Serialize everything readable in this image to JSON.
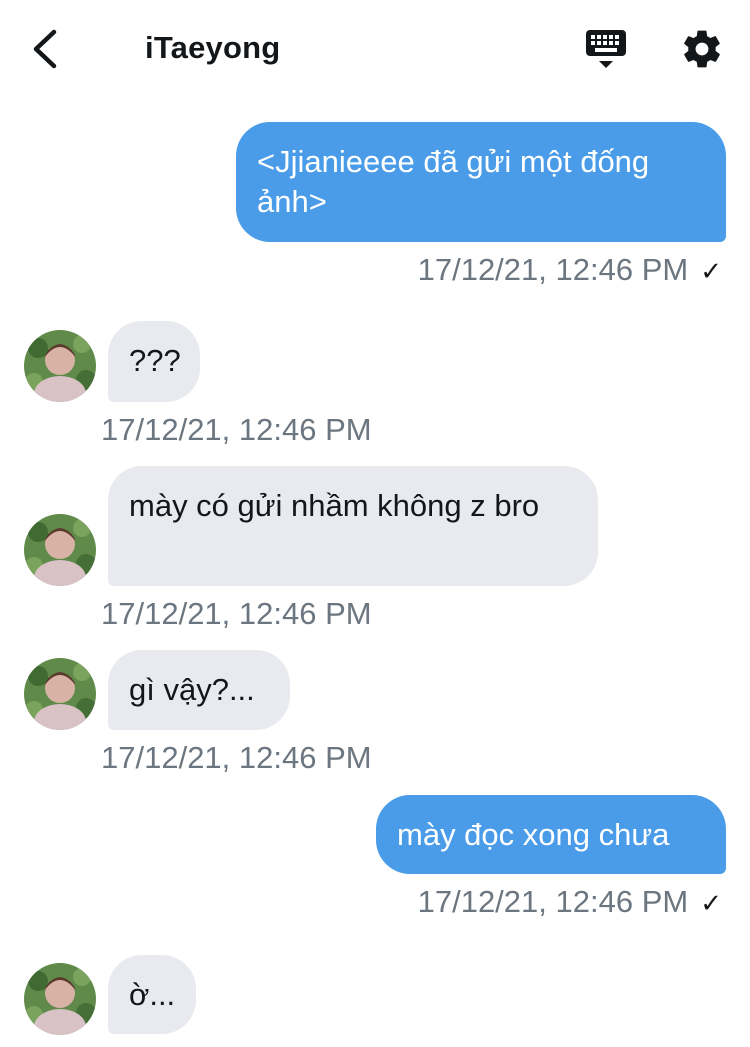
{
  "header": {
    "title": "iTaeyong",
    "icons": {
      "back": "chevron-left-icon",
      "keyboard": "keyboard-icon",
      "settings": "gear-icon"
    }
  },
  "colors": {
    "outgoing": "#4a9ce8",
    "incoming": "#e8eaef",
    "timestamp": "#6b7680"
  },
  "messages": [
    {
      "direction": "outgoing",
      "text": "<Jjianieeee đã gửi một đống ảnh>",
      "timestamp": "17/12/21, 12:46 PM",
      "status_icon": "check-icon"
    },
    {
      "direction": "incoming",
      "text": "???",
      "timestamp": "17/12/21, 12:46 PM"
    },
    {
      "direction": "incoming",
      "text": "mày có gửi nhầm không z bro",
      "timestamp": "17/12/21, 12:46 PM"
    },
    {
      "direction": "incoming",
      "text": "gì vậy?...",
      "timestamp": "17/12/21, 12:46 PM"
    },
    {
      "direction": "outgoing",
      "text": "mày đọc xong chưa",
      "timestamp": "17/12/21, 12:46 PM",
      "status_icon": "check-icon"
    },
    {
      "direction": "incoming",
      "text": "ờ...",
      "timestamp": ""
    }
  ]
}
